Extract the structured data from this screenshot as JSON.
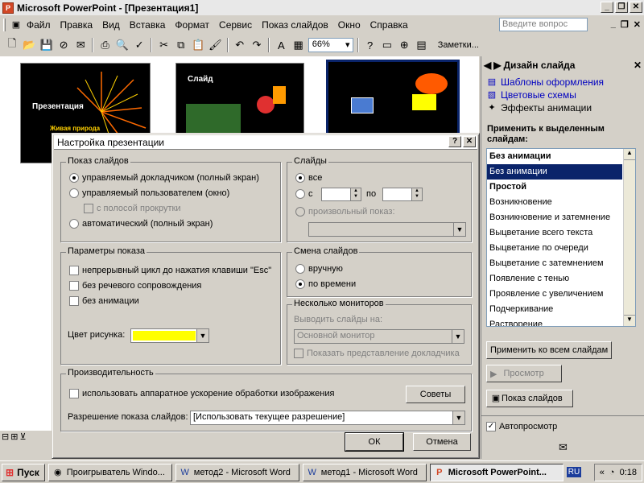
{
  "window": {
    "title": "Microsoft PowerPoint - [Презентация1]",
    "app_icon_letter": "P"
  },
  "menu": {
    "items": [
      "Файл",
      "Правка",
      "Вид",
      "Вставка",
      "Формат",
      "Сервис",
      "Показ слайдов",
      "Окно",
      "Справка"
    ],
    "ask_placeholder": "Введите вопрос"
  },
  "toolbar": {
    "zoom": "66%",
    "notes_label": "Заметки..."
  },
  "slides": {
    "slide1_title": "Презентация",
    "slide1_subtitle": "Живая природа",
    "slide2_title": "Слайд"
  },
  "taskpane": {
    "title": "Дизайн слайда",
    "links": [
      "Шаблоны оформления",
      "Цветовые схемы",
      "Эффекты анимации"
    ],
    "apply_label": "Применить к выделенным слайдам:",
    "list_items": [
      {
        "text": "Без анимации",
        "bold": true,
        "selected": false
      },
      {
        "text": "Без анимации",
        "bold": false,
        "selected": true
      },
      {
        "text": "Простой",
        "bold": true,
        "selected": false
      },
      {
        "text": "Возникновение",
        "bold": false,
        "selected": false
      },
      {
        "text": "Возникновение и затемнение",
        "bold": false,
        "selected": false
      },
      {
        "text": "Выцветание всего текста",
        "bold": false,
        "selected": false
      },
      {
        "text": "Выцветание по очереди",
        "bold": false,
        "selected": false
      },
      {
        "text": "Выцветание с затемнением",
        "bold": false,
        "selected": false
      },
      {
        "text": "Появление с тенью",
        "bold": false,
        "selected": false
      },
      {
        "text": "Проявление с увеличением",
        "bold": false,
        "selected": false
      },
      {
        "text": "Подчеркивание",
        "bold": false,
        "selected": false
      },
      {
        "text": "Растворение",
        "bold": false,
        "selected": false
      }
    ],
    "apply_all_button": "Применить ко всем слайдам",
    "play_button": "Просмотр",
    "slideshow_button": "Показ слайдов",
    "autopreview_label": "Автопросмотр",
    "autopreview_checked": true
  },
  "dialog": {
    "title": "Настройка презентации",
    "show_type": {
      "group": "Показ слайдов",
      "opt_speaker": "управляемый докладчиком (полный экран)",
      "opt_individual": "управляемый пользователем (окно)",
      "opt_scrollbar": "с полосой прокрутки",
      "opt_kiosk": "автоматический (полный экран)"
    },
    "slides": {
      "group": "Слайды",
      "opt_all": "все",
      "opt_from": "с",
      "to_label": "по",
      "opt_custom": "произвольный показ:"
    },
    "show_options": {
      "group": "Параметры показа",
      "loop": "непрерывный цикл до нажатия клавиши \"Esc\"",
      "no_narration": "без речевого сопровождения",
      "no_animation": "без анимации",
      "pen_color_label": "Цвет рисунка:",
      "pen_color": "#ffff00"
    },
    "advance": {
      "group": "Смена слайдов",
      "manual": "вручную",
      "timings": "по времени"
    },
    "monitors": {
      "group": "Несколько мониторов",
      "display_label": "Выводить слайды на:",
      "display_value": "Основной монитор",
      "presenter_view": "Показать представление докладчика"
    },
    "performance": {
      "group": "Производительность",
      "hw_accel": "использовать аппаратное ускорение обработки изображения",
      "tips_button": "Советы",
      "resolution_label": "Разрешение показа слайдов:",
      "resolution_value": "[Использовать текущее разрешение]"
    },
    "ok_button": "ОК",
    "cancel_button": "Отмена"
  },
  "taskbar": {
    "start": "Пуск",
    "tasks": [
      {
        "label": "Проигрыватель Windo...",
        "active": false,
        "icon": "media-player-icon"
      },
      {
        "label": "метод2 - Microsoft Word",
        "active": false,
        "icon": "word-icon"
      },
      {
        "label": "метод1 - Microsoft Word",
        "active": false,
        "icon": "word-icon"
      },
      {
        "label": "Microsoft PowerPoint...",
        "active": true,
        "icon": "powerpoint-icon"
      }
    ],
    "lang": "RU",
    "clock": "0:18"
  },
  "colors": {
    "selection": "#0a246a",
    "link": "#0000c0"
  }
}
